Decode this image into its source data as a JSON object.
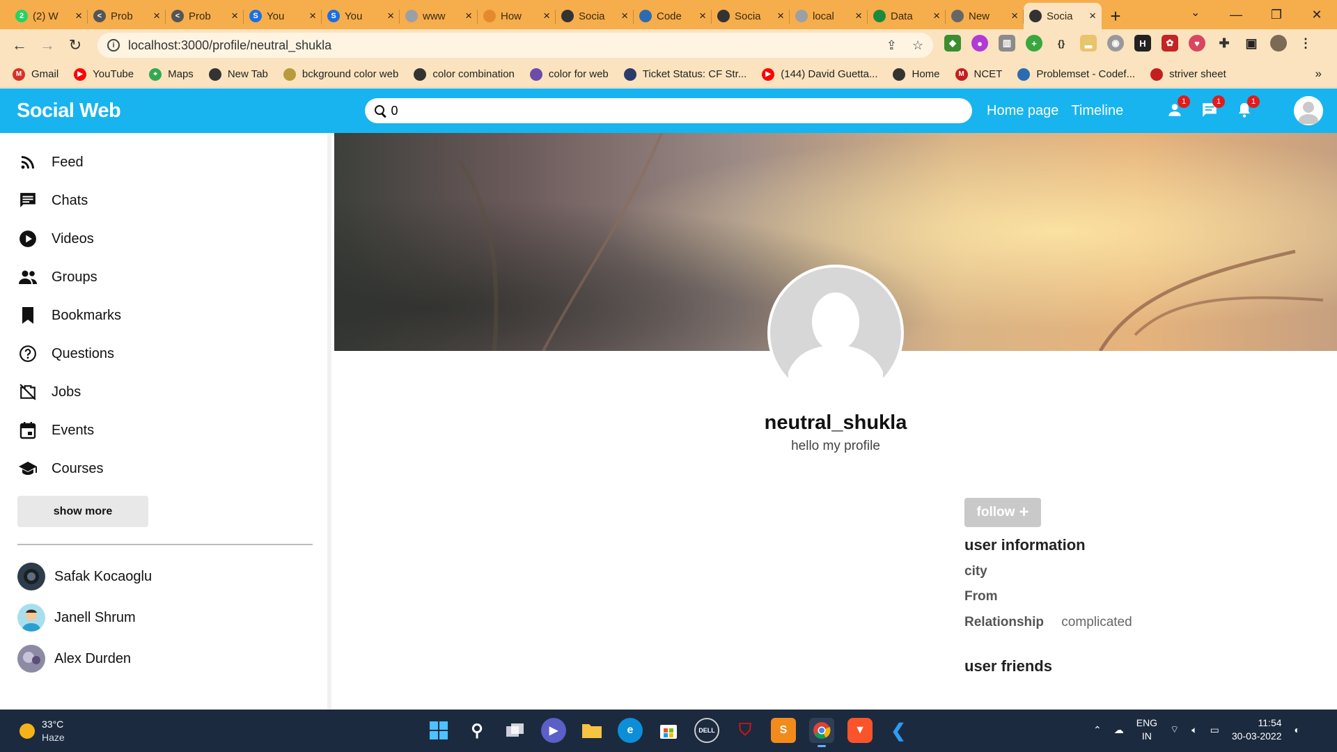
{
  "browser": {
    "tabs": [
      {
        "title": "(2) W",
        "icon": "whatsapp-icon",
        "color": "#25D366",
        "glyph": "2"
      },
      {
        "title": "Prob",
        "icon": "codeforces-icon",
        "color": "#555555",
        "glyph": "<"
      },
      {
        "title": "Prob",
        "icon": "codeforces-icon",
        "color": "#555555",
        "glyph": "<"
      },
      {
        "title": "You",
        "icon": "skype-icon",
        "color": "#1d6fe0",
        "glyph": "S"
      },
      {
        "title": "You",
        "icon": "skype-icon",
        "color": "#1d6fe0",
        "glyph": "S"
      },
      {
        "title": "www",
        "icon": "globe-icon",
        "color": "#9aa0a6",
        "glyph": ""
      },
      {
        "title": "How",
        "icon": "flame-icon",
        "color": "#e38b2c",
        "glyph": ""
      },
      {
        "title": "Socia",
        "icon": "globe-icon",
        "color": "#333333",
        "glyph": ""
      },
      {
        "title": "Code",
        "icon": "chart-icon",
        "color": "#2b6cb0",
        "glyph": ""
      },
      {
        "title": "Socia",
        "icon": "globe-icon",
        "color": "#333333",
        "glyph": ""
      },
      {
        "title": "local",
        "icon": "globe-icon",
        "color": "#9aa0a6",
        "glyph": ""
      },
      {
        "title": "Data",
        "icon": "mongodb-icon",
        "color": "#1b8a3c",
        "glyph": ""
      },
      {
        "title": "New",
        "icon": "chrome-icon",
        "color": "#666666",
        "glyph": ""
      },
      {
        "title": "Socia",
        "icon": "globe-icon",
        "color": "#333333",
        "glyph": "",
        "active": true
      }
    ],
    "url": "localhost:3000/profile/neutral_shukla",
    "bookmarks": [
      {
        "label": "Gmail",
        "icon": "gmail-icon",
        "color": "#d93025",
        "glyph": "M"
      },
      {
        "label": "YouTube",
        "icon": "youtube-icon",
        "color": "#ff0000",
        "glyph": "▶"
      },
      {
        "label": "Maps",
        "icon": "maps-icon",
        "color": "#34a853",
        "glyph": "⌖"
      },
      {
        "label": "New Tab",
        "icon": "globe-icon",
        "color": "#333333",
        "glyph": ""
      },
      {
        "label": "bckground color web",
        "icon": "globe-icon",
        "color": "#b89b3b",
        "glyph": ""
      },
      {
        "label": "color combination",
        "icon": "globe-icon",
        "color": "#333333",
        "glyph": ""
      },
      {
        "label": "color for web",
        "icon": "bucket-icon",
        "color": "#6b4ca8",
        "glyph": ""
      },
      {
        "label": "Ticket Status: CF Str...",
        "icon": "box-icon",
        "color": "#2b3b6b",
        "glyph": ""
      },
      {
        "label": "(144) David Guetta...",
        "icon": "youtube-icon",
        "color": "#ff0000",
        "glyph": "▶"
      },
      {
        "label": "Home",
        "icon": "globe-icon",
        "color": "#333333",
        "glyph": ""
      },
      {
        "label": "NCET",
        "icon": "ncet-icon",
        "color": "#c41e1e",
        "glyph": "M"
      },
      {
        "label": "Problemset - Codef...",
        "icon": "chart-icon",
        "color": "#2b6cb0",
        "glyph": ""
      },
      {
        "label": "striver sheet",
        "icon": "tuf-icon",
        "color": "#c41e1e",
        "glyph": ""
      }
    ]
  },
  "app": {
    "logo": "Social Web",
    "search_value": "0",
    "links": [
      "Home page",
      "Timeline"
    ],
    "badges": {
      "friends": "1",
      "messages": "1",
      "notifications": "1"
    }
  },
  "sidebar": {
    "items": [
      {
        "label": "Feed",
        "icon": "rss-feed-icon"
      },
      {
        "label": "Chats",
        "icon": "chat-icon"
      },
      {
        "label": "Videos",
        "icon": "play-circle-icon"
      },
      {
        "label": "Groups",
        "icon": "group-icon"
      },
      {
        "label": "Bookmarks",
        "icon": "bookmark-icon"
      },
      {
        "label": "Questions",
        "icon": "help-circle-icon"
      },
      {
        "label": "Jobs",
        "icon": "work-off-icon"
      },
      {
        "label": "Events",
        "icon": "calendar-icon"
      },
      {
        "label": "Courses",
        "icon": "school-icon"
      }
    ],
    "show_more": "show more",
    "friends": [
      {
        "name": "Safak Kocaoglu"
      },
      {
        "name": "Janell Shrum"
      },
      {
        "name": "Alex Durden"
      }
    ]
  },
  "profile": {
    "username": "neutral_shukla",
    "description": "hello my profile",
    "follow_label": "follow",
    "info_title": "user information",
    "info": [
      {
        "key": "city",
        "value": ""
      },
      {
        "key": "From",
        "value": ""
      },
      {
        "key": "Relationship",
        "value": "complicated"
      }
    ],
    "friends_title": "user friends"
  },
  "taskbar": {
    "temperature": "33°C",
    "weather": "Haze",
    "lang_1": "ENG",
    "lang_2": "IN",
    "time": "11:54",
    "date": "30-03-2022"
  }
}
